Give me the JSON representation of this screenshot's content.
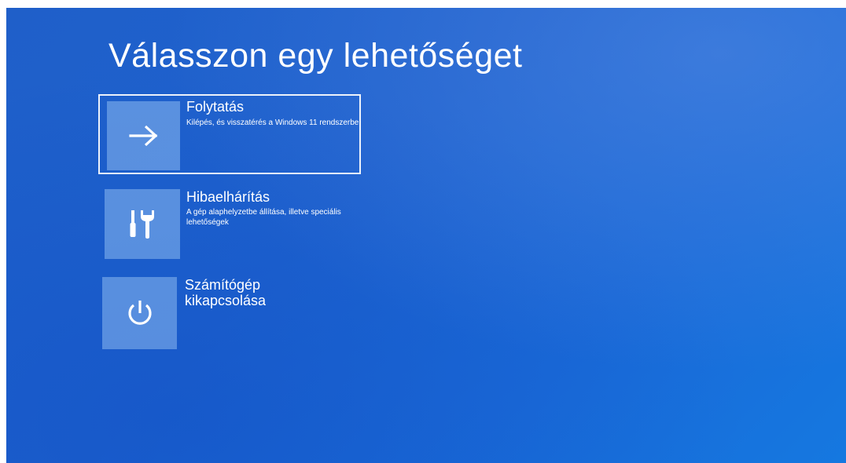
{
  "page": {
    "title": "Válasszon egy lehetőséget"
  },
  "options": [
    {
      "label": "Folytatás",
      "description": "Kilépés, és visszatérés a Windows 11 rendszerbe",
      "icon": "arrow-right-icon",
      "selected": true
    },
    {
      "label": "Hibaelhárítás",
      "description": "A gép alaphelyzetbe állítása, illetve speciális lehetőségek",
      "icon": "tools-icon",
      "selected": false
    },
    {
      "label": "Számítógép kikapcsolása",
      "description": "",
      "icon": "power-icon",
      "selected": false
    }
  ],
  "colors": {
    "background": "#1e62cf",
    "tile": "#6d9ee6",
    "text": "#ffffff"
  }
}
